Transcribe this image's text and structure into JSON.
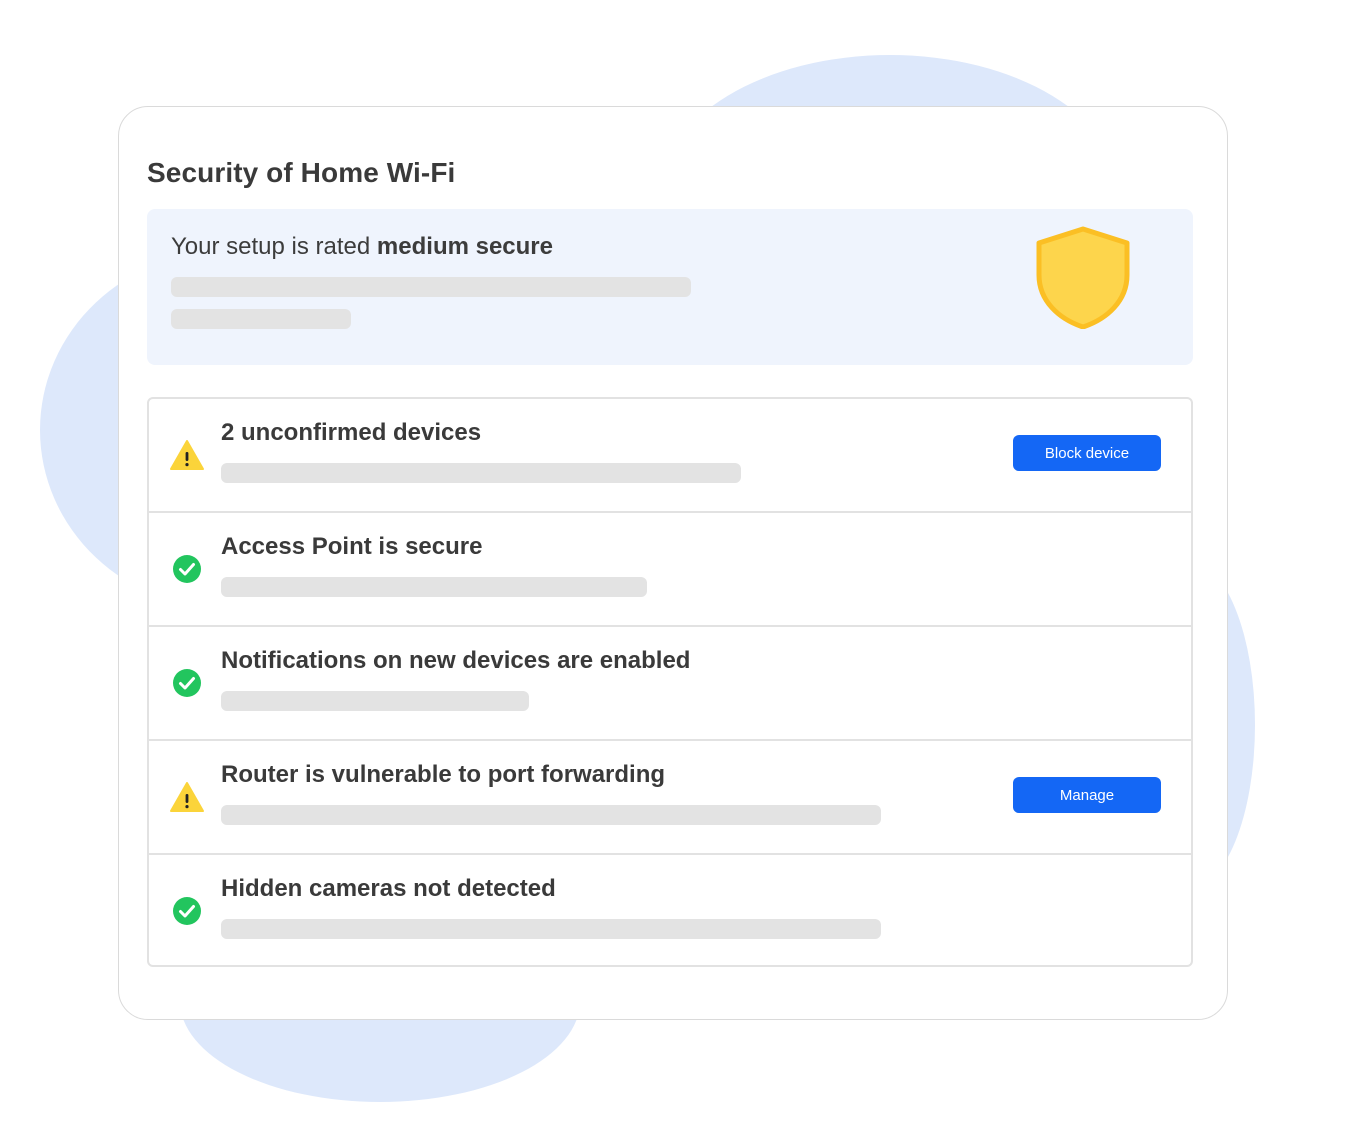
{
  "panel": {
    "title": "Security of Home Wi-Fi",
    "rating": {
      "prefix": "Your setup is rated ",
      "level": "medium secure",
      "icon": "shield-icon"
    }
  },
  "checks": [
    {
      "status": "warning",
      "icon": "warning-icon",
      "title": "2 unconfirmed devices",
      "action": "Block device"
    },
    {
      "status": "ok",
      "icon": "check-circle-icon",
      "title": "Access Point is secure"
    },
    {
      "status": "ok",
      "icon": "check-circle-icon",
      "title": "Notifications on new devices are enabled"
    },
    {
      "status": "warning",
      "icon": "warning-icon",
      "title": "Router is vulnerable to port forwarding",
      "action": "Manage"
    },
    {
      "status": "ok",
      "icon": "check-circle-icon",
      "title": "Hidden cameras not detected"
    }
  ],
  "colors": {
    "accent": "#1467f5",
    "warning": "#fbd43a",
    "ok": "#22c55e",
    "shield": "#fdd54c",
    "background_blob": "#dde8fb"
  }
}
